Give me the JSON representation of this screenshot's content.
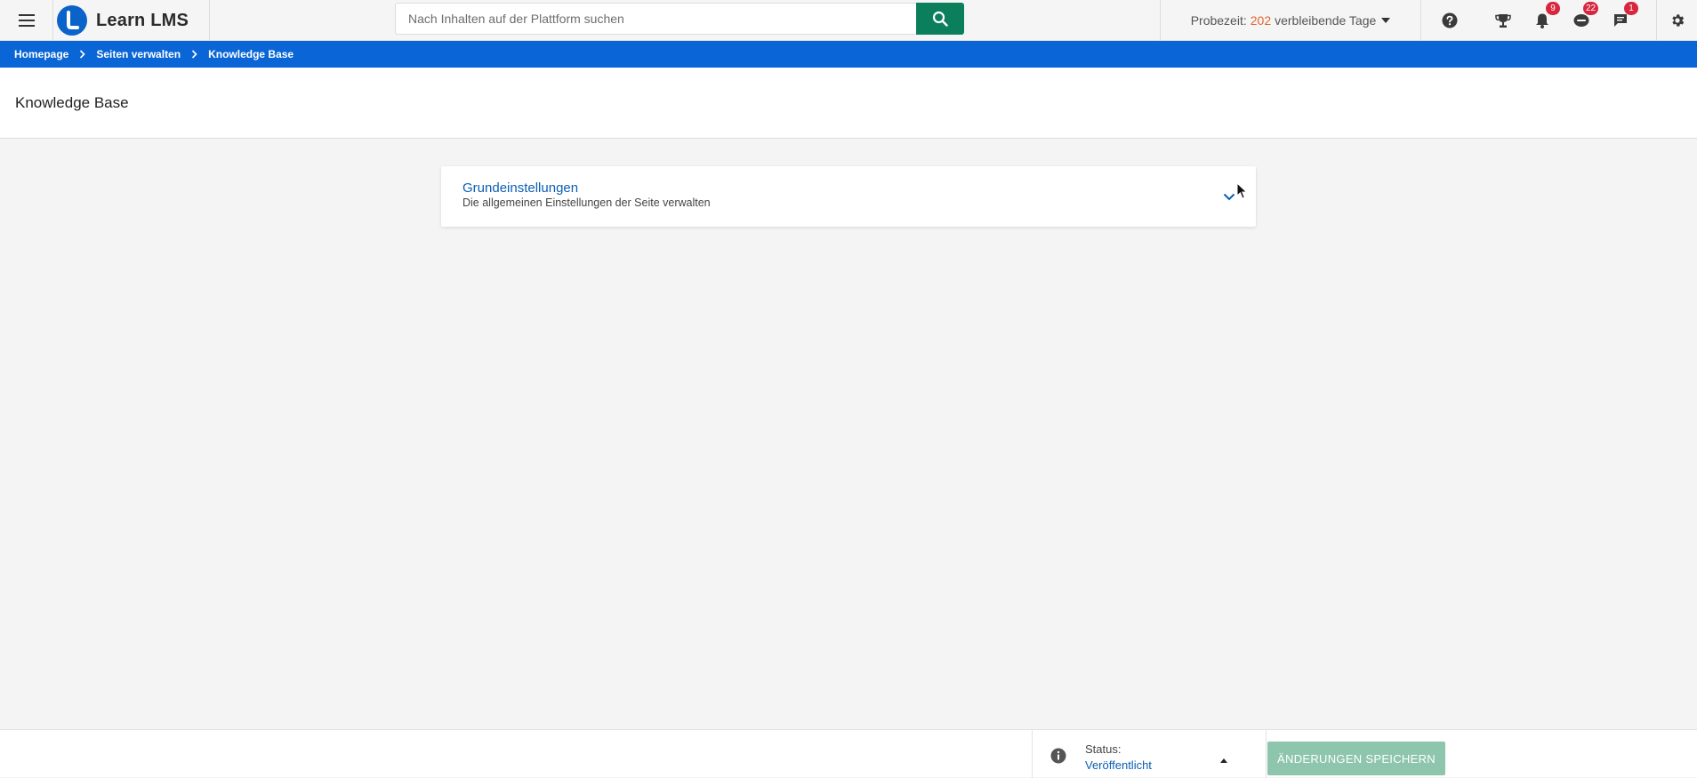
{
  "header": {
    "brand_name": "Learn LMS",
    "search": {
      "placeholder": "Nach Inhalten auf der Plattform suchen",
      "value": ""
    },
    "trial": {
      "prefix": "Probezeit:",
      "days": "202",
      "suffix": "verbleibende Tage"
    },
    "badges": {
      "notifications": "9",
      "mentions": "22",
      "messages": "1"
    },
    "icons": [
      "menu-icon",
      "search-icon",
      "help-icon",
      "trophy-icon",
      "bell-icon",
      "mention-icon",
      "chat-icon",
      "gear-icon"
    ]
  },
  "breadcrumb": {
    "items": [
      "Homepage",
      "Seiten verwalten",
      "Knowledge Base"
    ]
  },
  "page": {
    "title": "Knowledge Base"
  },
  "card": {
    "title": "Grundeinstellungen",
    "subtitle": "Die allgemeinen Einstellungen der Seite verwalten"
  },
  "footer": {
    "status_label": "Status:",
    "status_value": "Veröffentlicht",
    "save_label": "ÄNDERUNGEN SPEICHERN"
  },
  "colors": {
    "brand_blue": "#0a66d6",
    "search_green": "#0b7f5c",
    "save_disabled": "#8ec5ad",
    "link_blue": "#0a5fb4",
    "trial_orange": "#e0642a",
    "badge_red": "#d7263d"
  }
}
